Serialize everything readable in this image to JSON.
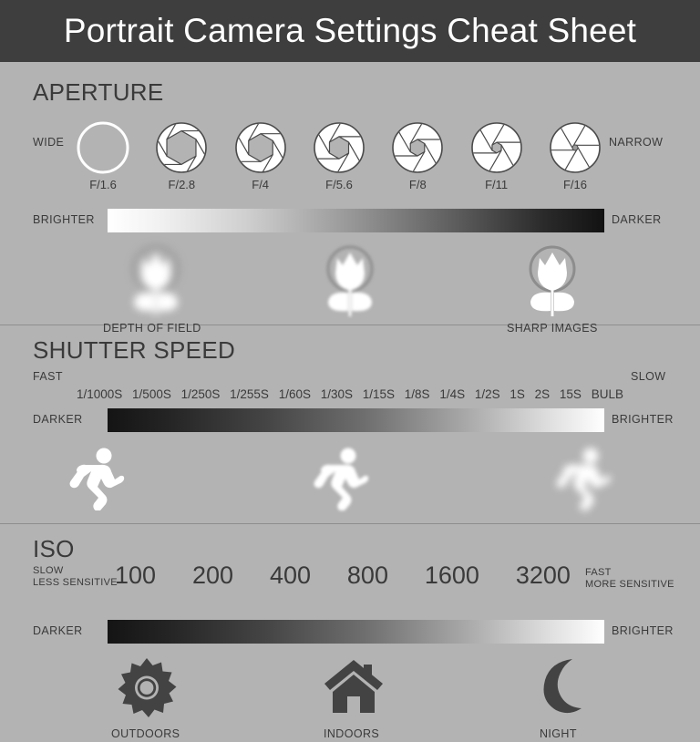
{
  "header": {
    "title": "Portrait Camera Settings Cheat Sheet"
  },
  "aperture": {
    "title": "APERTURE",
    "left_label": "WIDE",
    "right_label": "NARROW",
    "f_stops": [
      "F/1.6",
      "F/2.8",
      "F/4",
      "F/5.6",
      "F/8",
      "F/11",
      "F/16"
    ],
    "gradient": {
      "left_label": "BRIGHTER",
      "right_label": "DARKER",
      "from": "#ffffff",
      "to": "#121212"
    },
    "effects": [
      {
        "label": "DEPTH OF FIELD",
        "blur": "high"
      },
      {
        "label": "",
        "blur": "medium"
      },
      {
        "label": "SHARP IMAGES",
        "blur": "none"
      }
    ]
  },
  "shutter": {
    "title": "SHUTTER SPEED",
    "left_label": "FAST",
    "right_label": "SLOW",
    "values": [
      "1/1000S",
      "1/500S",
      "1/250S",
      "1/255S",
      "1/60S",
      "1/30S",
      "1/15S",
      "1/8S",
      "1/4S",
      "1/2S",
      "1S",
      "2S",
      "15S",
      "BULB"
    ],
    "gradient": {
      "left_label": "DARKER",
      "right_label": "BRIGHTER",
      "from": "#141414",
      "to": "#ffffff"
    },
    "motion": [
      {
        "blur": "none"
      },
      {
        "blur": "medium"
      },
      {
        "blur": "high"
      }
    ]
  },
  "iso": {
    "title": "ISO",
    "left_label_line1": "SLOW",
    "left_label_line2": "LESS SENSITIVE",
    "right_label_line1": "FAST",
    "right_label_line2": "MORE SENSITIVE",
    "values": [
      "100",
      "200",
      "400",
      "800",
      "1600",
      "3200"
    ],
    "gradient": {
      "left_label": "DARKER",
      "right_label": "BRIGHTER",
      "from": "#141414",
      "to": "#ffffff"
    },
    "scenes": [
      {
        "label": "OUTDOORS",
        "icon": "sun-icon"
      },
      {
        "label": "INDOORS",
        "icon": "house-icon"
      },
      {
        "label": "NIGHT",
        "icon": "moon-icon"
      }
    ]
  },
  "colors": {
    "background": "#b3b3b3",
    "header_bg": "#3e3e3e",
    "text": "#3a3a3a",
    "icon_dark": "#434343",
    "icon_light": "#ffffff"
  }
}
